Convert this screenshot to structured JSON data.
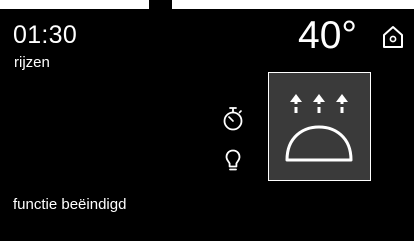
{
  "display": {
    "time": "01:30",
    "program": "rijzen",
    "temperature": "40°",
    "status": "functie beëindigd"
  },
  "icons": {
    "home": "home-icon",
    "timer": "stopwatch-icon",
    "light": "light-bulb-icon",
    "function": "proofing-function-icon"
  },
  "colors": {
    "background": "#000000",
    "text": "#ffffff",
    "tile": "#3a3a3a"
  }
}
